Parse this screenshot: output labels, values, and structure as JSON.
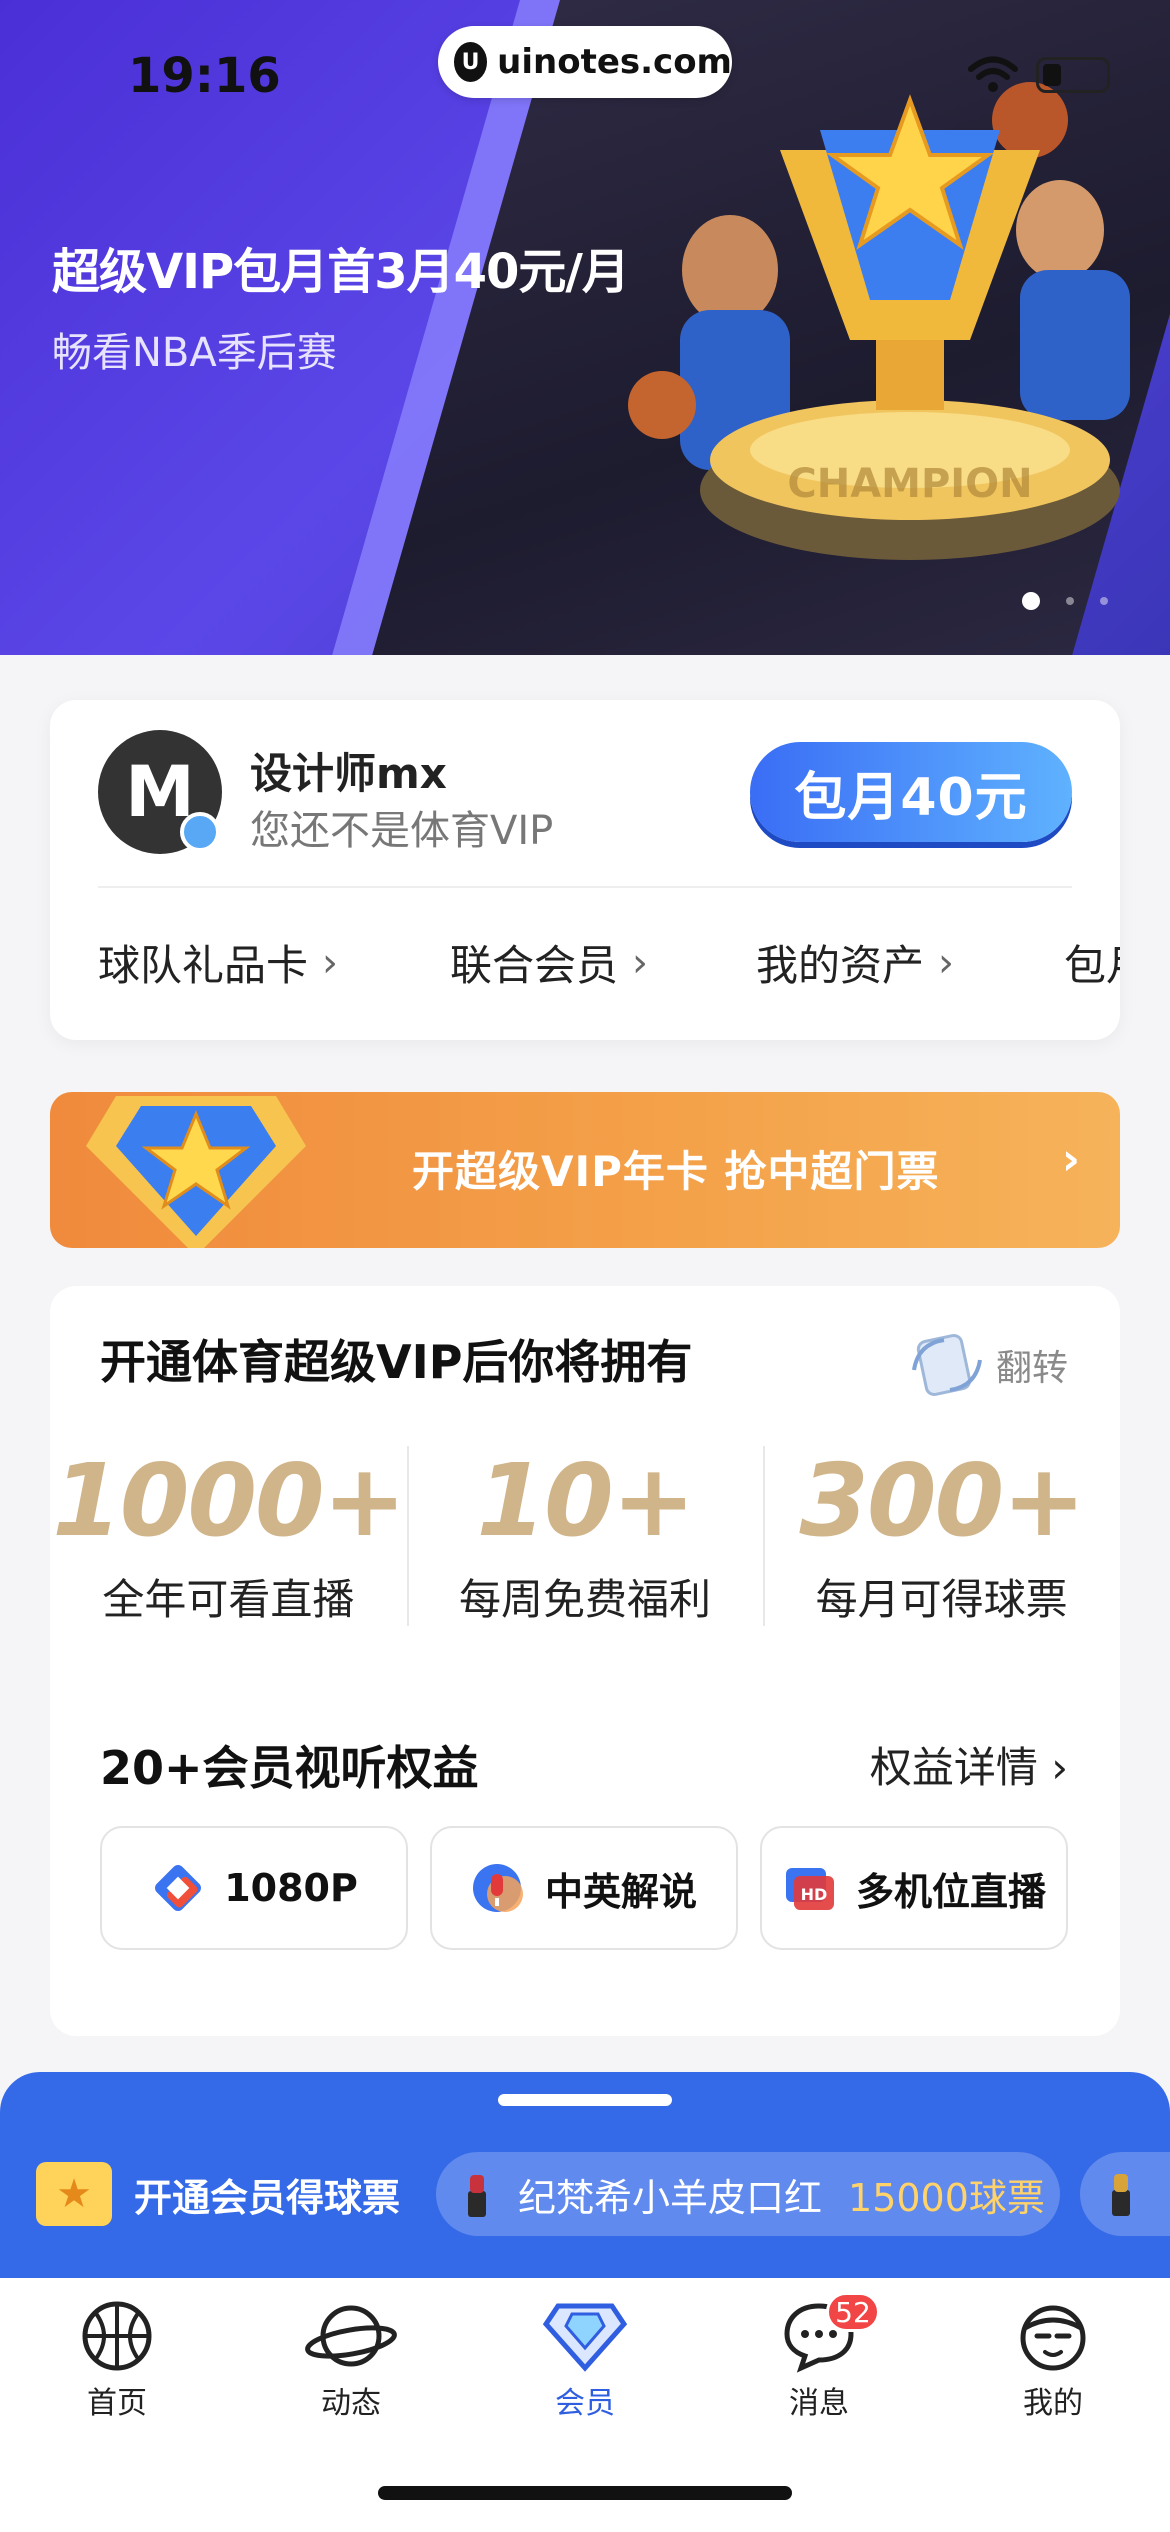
{
  "status_bar": {
    "time": "19:16",
    "url": "uinotes.com",
    "url_logo": "U"
  },
  "hero": {
    "title": "超级VIP包月首3月40元/月",
    "subtitle": "畅看NBA季后赛",
    "trophy_text": "CHAMPION",
    "slide_index": 0,
    "slide_count": 3
  },
  "profile": {
    "avatar_text": "M",
    "username": "设计师mx",
    "vip_status": "您还不是体育VIP",
    "buy_button": "包月40元",
    "quick_links": [
      {
        "label": "球队礼品卡"
      },
      {
        "label": "联合会员"
      },
      {
        "label": "我的资产"
      },
      {
        "label": "包月"
      }
    ]
  },
  "promo": {
    "text": "开超级VIP年卡 抢中超门票",
    "chevron": "›"
  },
  "benefits": {
    "title": "开通体育超级VIP后你将拥有",
    "flip_label": "翻转",
    "stats": [
      {
        "value": "1000+",
        "label": "全年可看直播"
      },
      {
        "value": "10+",
        "label": "每周免费福利"
      },
      {
        "value": "300+",
        "label": "每月可得球票"
      }
    ],
    "sub_title": "20+会员视听权益",
    "detail_link": "权益详情 ›",
    "chips": [
      {
        "label": "1080P",
        "icon": "resolution-icon"
      },
      {
        "label": "中英解说",
        "icon": "microphone-icon"
      },
      {
        "label": "多机位直播",
        "icon": "hd-camera-icon"
      }
    ]
  },
  "ticker": {
    "label": "开通会员得球票",
    "item_name": "纪梵希小羊皮口红",
    "item_price": "15000球票"
  },
  "tabbar": {
    "tabs": [
      {
        "label": "首页",
        "icon": "basketball-icon"
      },
      {
        "label": "动态",
        "icon": "planet-icon"
      },
      {
        "label": "会员",
        "icon": "diamond-icon",
        "active": true
      },
      {
        "label": "消息",
        "icon": "chat-bubble-icon",
        "badge": "52"
      },
      {
        "label": "我的",
        "icon": "profile-face-icon"
      }
    ]
  },
  "colors": {
    "accent": "#2f5ee0",
    "gold": "#d1b58a",
    "promo_orange": "#f08a3c",
    "ticker_blue": "#3469e8",
    "badge_red": "#f24545"
  }
}
